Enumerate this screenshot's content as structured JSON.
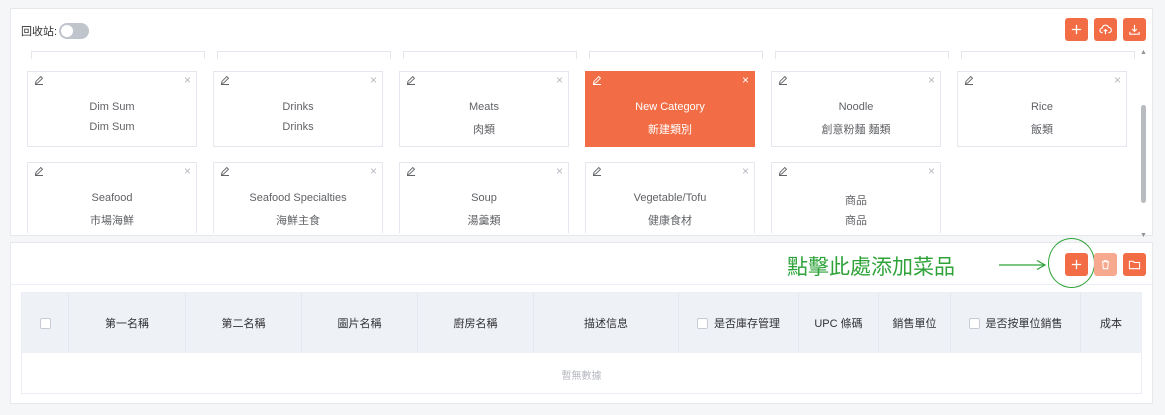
{
  "recycle_label": "回收站:",
  "categories": [
    {
      "name1": "Dim Sum",
      "name2": "Dim Sum",
      "active": false
    },
    {
      "name1": "Drinks",
      "name2": "Drinks",
      "active": false
    },
    {
      "name1": "Meats",
      "name2": "肉類",
      "active": false
    },
    {
      "name1": "New Category",
      "name2": "新建類別",
      "active": true
    },
    {
      "name1": "Noodle",
      "name2": "創意粉麵 麵類",
      "active": false
    },
    {
      "name1": "Rice",
      "name2": "飯類",
      "active": false
    },
    {
      "name1": "Seafood",
      "name2": "市場海鮮",
      "active": false
    },
    {
      "name1": "Seafood Specialties",
      "name2": "海鮮主食",
      "active": false
    },
    {
      "name1": "Soup",
      "name2": "湯羹類",
      "active": false
    },
    {
      "name1": "Vegetable/Tofu",
      "name2": "健康食材",
      "active": false
    },
    {
      "name1": "商品",
      "name2": "商品",
      "active": false
    }
  ],
  "card_close_glyph": "×",
  "annotation": {
    "text": "點擊此處添加菜品"
  },
  "table": {
    "columns": [
      "第一名稱",
      "第二名稱",
      "圖片名稱",
      "廚房名稱",
      "描述信息",
      "是否庫存管理",
      "UPC 條碼",
      "銷售單位",
      "是否按單位銷售",
      "成本"
    ],
    "empty_text": "暫無數據"
  },
  "colors": {
    "accent": "#f26d45",
    "accent_light": "#f7a98f",
    "annotation": "#2fa33a"
  },
  "icons": {
    "top": [
      "plus-icon",
      "cloud-upload-icon",
      "download-icon"
    ],
    "bottom": [
      "plus-icon",
      "trash-icon",
      "folder-icon"
    ]
  }
}
